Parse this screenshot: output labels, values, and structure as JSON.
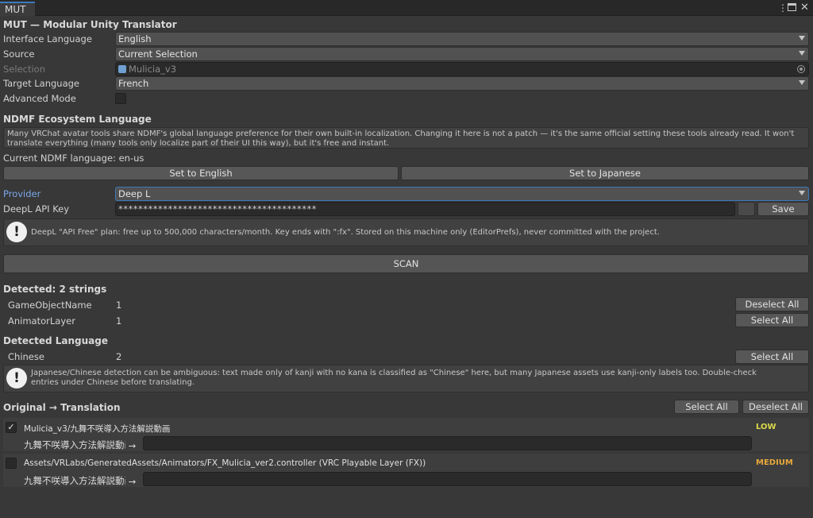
{
  "window": {
    "tab_label": "MUT",
    "menu_icon": "kebab-icon",
    "maximize_icon": "maximize-icon",
    "close_icon": "close-icon"
  },
  "header": {
    "title": "MUT — Modular Unity Translator"
  },
  "settings": {
    "interface_language": {
      "label": "Interface Language",
      "value": "English"
    },
    "source": {
      "label": "Source",
      "value": "Current Selection"
    },
    "selection": {
      "label": "Selection",
      "value": "Mulicia_v3"
    },
    "target_language": {
      "label": "Target Language",
      "value": "French"
    },
    "advanced_mode": {
      "label": "Advanced Mode",
      "checked": false
    }
  },
  "ndmf": {
    "title": "NDMF Ecosystem Language",
    "help": "Many VRChat avatar tools share NDMF's global language preference for their own built-in localization. Changing it here is not a patch — it's the same official setting these tools already read. It won't translate everything (many tools only localize part of their UI this way), but it's free and instant.",
    "current": "Current NDMF language: en-us",
    "set_english": "Set to English",
    "set_japanese": "Set to Japanese"
  },
  "provider": {
    "label": "Provider",
    "value": "Deep L",
    "api_key_label": "DeepL API Key",
    "api_key_value": "****************************************",
    "save_label": "Save",
    "help": "DeepL \"API Free\" plan: free up to 500,000 characters/month. Key ends with \":fx\". Stored on this machine only (EditorPrefs), never committed with the project."
  },
  "scan": {
    "label": "SCAN"
  },
  "detected": {
    "title": "Detected: 2 strings",
    "rows": [
      {
        "name": "GameObjectName",
        "count": "1",
        "button": "Deselect All"
      },
      {
        "name": "AnimatorLayer",
        "count": "1",
        "button": "Select All"
      }
    ]
  },
  "detected_language": {
    "title": "Detected Language",
    "rows": [
      {
        "name": "Chinese",
        "count": "2",
        "button": "Select All"
      }
    ],
    "help": "Japanese/Chinese detection can be ambiguous: text made only of kanji with no kana is classified as \"Chinese\" here, but many Japanese assets use kanji-only labels too. Double-check entries under Chinese before translating."
  },
  "translation": {
    "title": "Original → Translation",
    "select_all": "Select All",
    "deselect_all": "Deselect All",
    "entries": [
      {
        "checked": true,
        "path": "Mulicia_v3/九舞不咲導入方法解説動画",
        "confidence": "LOW",
        "confidence_color": "#d9d94a",
        "original": "九舞不咲導入方法解説動画",
        "arrow": "→",
        "translation": ""
      },
      {
        "checked": false,
        "path": "Assets/VRLabs/GeneratedAssets/Animators/FX_Mulicia_ver2.controller (VRC Playable Layer (FX))",
        "confidence": "MEDIUM",
        "confidence_color": "#e8a83a",
        "original": "九舞不咲導入方法解説動画",
        "arrow": "→",
        "translation": ""
      }
    ]
  }
}
